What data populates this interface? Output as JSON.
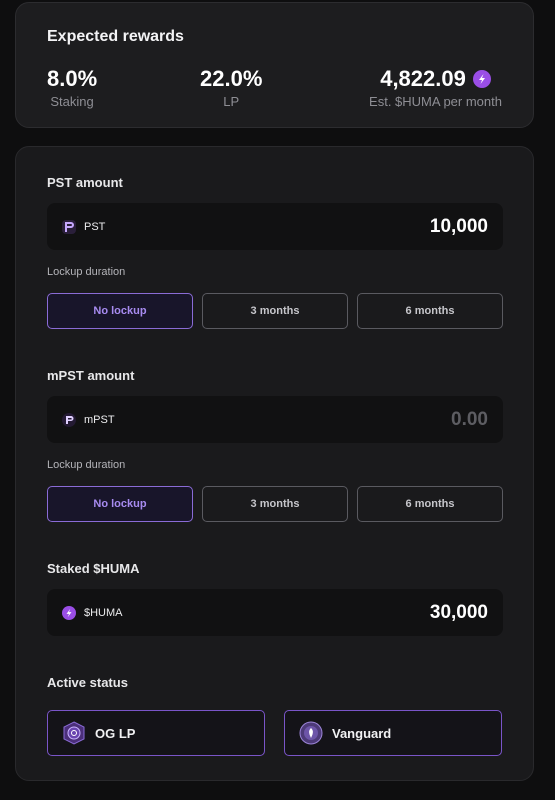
{
  "rewards": {
    "title": "Expected rewards",
    "staking": {
      "value": "8.0%",
      "label": "Staking"
    },
    "lp": {
      "value": "22.0%",
      "label": "LP"
    },
    "huma": {
      "value": "4,822.09",
      "label": "Est. $HUMA per month",
      "icon": "huma-bolt-icon"
    }
  },
  "pst": {
    "section_label": "PST amount",
    "token": "PST",
    "token_icon": "pst-icon",
    "amount": "10,000",
    "lockup_label": "Lockup duration",
    "lockup_options": [
      "No lockup",
      "3 months",
      "6 months"
    ],
    "lockup_selected": "No lockup"
  },
  "mpst": {
    "section_label": "mPST amount",
    "token": "mPST",
    "token_icon": "mpst-icon",
    "amount": "0.00",
    "lockup_label": "Lockup duration",
    "lockup_options": [
      "No lockup",
      "3 months",
      "6 months"
    ],
    "lockup_selected": "No lockup"
  },
  "huma": {
    "section_label": "Staked $HUMA",
    "token": "$HUMA",
    "token_icon": "huma-bolt-icon",
    "amount": "30,000"
  },
  "active_status": {
    "section_label": "Active status",
    "badges": [
      {
        "label": "OG LP",
        "icon": "og-lp-badge-icon"
      },
      {
        "label": "Vanguard",
        "icon": "vanguard-badge-icon"
      }
    ]
  },
  "colors": {
    "accent": "#9a4ee6",
    "active_border": "#8a6bd6",
    "active_text": "#a78bf0",
    "badge_border": "#7a55c8"
  }
}
